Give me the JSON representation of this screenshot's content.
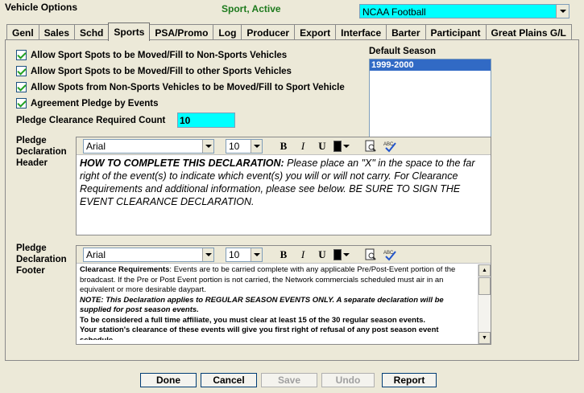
{
  "window": {
    "title": "Vehicle Options",
    "status": "Sport, Active",
    "sport_select": "NCAA Football"
  },
  "tabs": [
    {
      "label": "Genl"
    },
    {
      "label": "Sales"
    },
    {
      "label": "Schd"
    },
    {
      "label": "Sports"
    },
    {
      "label": "PSA/Promo"
    },
    {
      "label": "Log"
    },
    {
      "label": "Producer"
    },
    {
      "label": "Export"
    },
    {
      "label": "Interface"
    },
    {
      "label": "Barter"
    },
    {
      "label": "Participant"
    },
    {
      "label": "Great Plains G/L"
    }
  ],
  "options": [
    {
      "label": "Allow Sport Spots to be Moved/Fill to Non-Sports Vehicles",
      "checked": true
    },
    {
      "label": "Allow Sport Spots to be Moved/Fill to other Sports Vehicles",
      "checked": true
    },
    {
      "label": "Allow Spots from Non-Sports Vehicles to be Moved/Fill to Sport Vehicle",
      "checked": true
    },
    {
      "label": "Agreement Pledge by Events",
      "checked": true
    }
  ],
  "pledge_count": {
    "label": "Pledge Clearance Required Count",
    "value": "10"
  },
  "default_season": {
    "label": "Default Season",
    "items": [
      "1999-2000"
    ]
  },
  "header_editor": {
    "label_line1": "Pledge",
    "label_line2": "Declaration",
    "label_line3": "Header",
    "font": "Arial",
    "size": "10",
    "bold_text": "HOW TO COMPLETE THIS DECLARATION:",
    "body_text": " Please place an \"X\" in the space to the far right of the event(s) to indicate which event(s) you will or will not carry. For Clearance Requirements and additional information, please see below. BE SURE TO SIGN THE EVENT CLEARANCE DECLARATION."
  },
  "footer_editor": {
    "label_line1": "Pledge",
    "label_line2": "Declaration",
    "label_line3": "Footer",
    "font": "Arial",
    "size": "10",
    "p1_bold": "Clearance Requirements",
    "p1_text": ": Events are to be carried complete with any applicable Pre/Post-Event portion of the broadcast. If the Pre or Post Event portion is not carried, the Network commercials scheduled must air in an equivalent or more desirable daypart.",
    "p2": "NOTE: This Declaration applies to REGULAR SEASON EVENTS ONLY. A separate declaration will be supplied for post season events.",
    "p3": "To be considered a full time affiliate, you must clear at least 15 of the 30 regular season events.",
    "p4": "Your station's clearance of these events will give you first right of refusal of any post season event schedule."
  },
  "toolbar": {
    "bold": "B",
    "italic": "I",
    "underline": "U"
  },
  "buttons": {
    "done": "Done",
    "cancel": "Cancel",
    "save": "Save",
    "undo": "Undo",
    "report": "Report"
  },
  "colors": {
    "accent": "#00ffff",
    "selection": "#316ac5",
    "status": "#1d7a1d"
  }
}
